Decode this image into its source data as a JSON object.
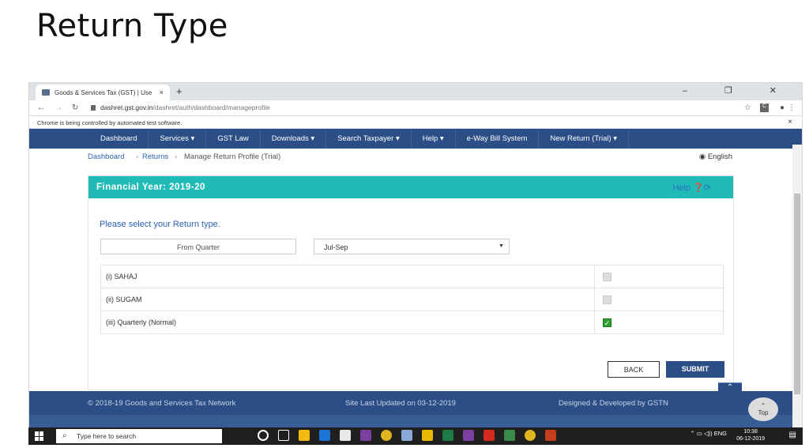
{
  "slide": {
    "title": "Return Type"
  },
  "browser": {
    "tab_title": "Goods & Services Tax (GST) | Use",
    "tab_close": "×",
    "new_tab": "+",
    "window_controls": "–  ❐  ✕",
    "url_host": "dashret.gst.gov.in",
    "url_path": "/dashret/auth/dashboard/manageprofile",
    "infobar": "Chrome is being controlled by automated test software.",
    "infobar_close": "×"
  },
  "navbar": {
    "items": [
      {
        "label": "Dashboard"
      },
      {
        "label": "Services ▾"
      },
      {
        "label": "GST Law"
      },
      {
        "label": "Downloads ▾"
      },
      {
        "label": "Search Taxpayer ▾"
      },
      {
        "label": "Help ▾"
      },
      {
        "label": "e-Way Bill System"
      },
      {
        "label": "New Return (Trial) ▾"
      }
    ]
  },
  "breadcrumb": {
    "dashboard": "Dashboard",
    "returns": "Returns",
    "current": "Manage Return Profile (Trial)",
    "sep": "›",
    "language": "English"
  },
  "panel": {
    "financial_year": "Financial Year: 2019-20",
    "help": "Help",
    "prompt": "Please select your Return type.",
    "from_quarter_label": "From Quarter",
    "quarter_value": "Jul-Sep",
    "quarter_caret": "▼",
    "return_types": [
      {
        "label": "(i) SAHAJ",
        "checked": false
      },
      {
        "label": "(ii) SUGAM",
        "checked": false
      },
      {
        "label": "(iii) Quarterly (Normal)",
        "checked": true
      }
    ],
    "back_label": "BACK",
    "submit_label": "SUBMIT"
  },
  "footer": {
    "copyright": "© 2018-19 Goods and Services Tax Network",
    "updated": "Site Last Updated on 03-12-2019",
    "designed": "Designed & Developed by GSTN",
    "top_label": "Top"
  },
  "taskbar": {
    "search_placeholder": "Type here to search",
    "lang": "ENG",
    "time": "10:38",
    "date": "06-12-2019"
  },
  "colors": {
    "nav_blue": "#2c4e86",
    "teal": "#20bbb7",
    "link_blue": "#2c63b0",
    "check_green": "#2fa02f"
  }
}
